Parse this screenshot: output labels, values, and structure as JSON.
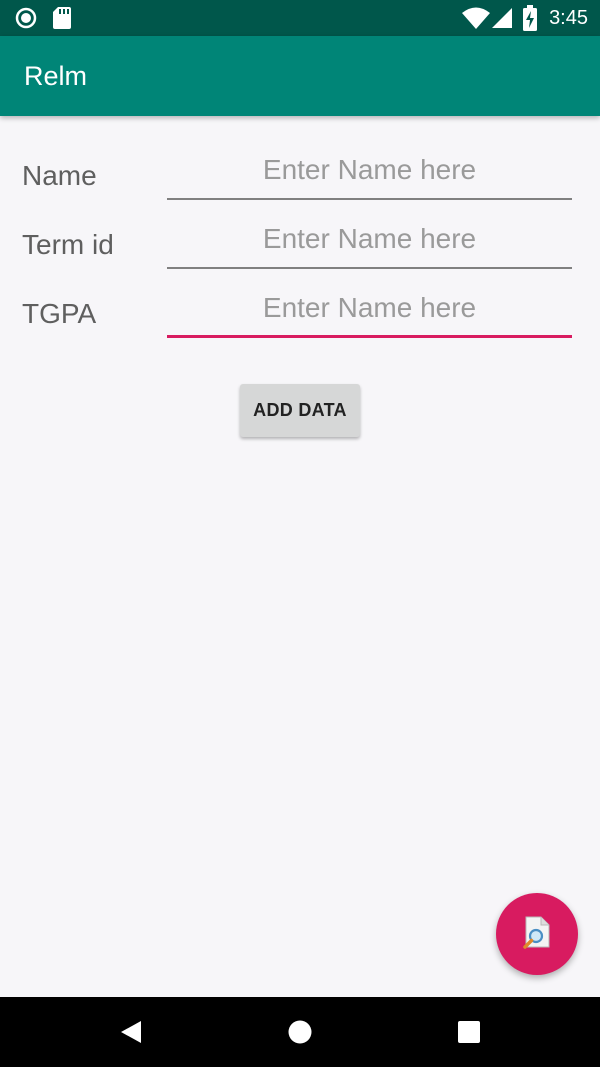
{
  "status_bar": {
    "time": "3:45",
    "icons": [
      "record-icon",
      "sd-card-icon",
      "wifi-icon",
      "cell-signal-icon",
      "battery-charging-icon"
    ]
  },
  "app_bar": {
    "title": "Relm"
  },
  "form": {
    "fields": [
      {
        "label": "Name",
        "value": "",
        "placeholder": "Enter Name here"
      },
      {
        "label": "Term id",
        "value": "",
        "placeholder": "Enter Name here"
      },
      {
        "label": "TGPA",
        "value": "",
        "placeholder": "Enter Name here",
        "focused": true
      }
    ],
    "add_button_label": "ADD DATA"
  },
  "fab": {
    "icon": "document-search-icon"
  },
  "nav_bar": {
    "buttons": [
      "back-icon",
      "home-icon",
      "recents-icon"
    ]
  },
  "colors": {
    "status_bar": "#00574b",
    "primary": "#008577",
    "accent": "#d81b60",
    "background": "#f7f6f9"
  }
}
